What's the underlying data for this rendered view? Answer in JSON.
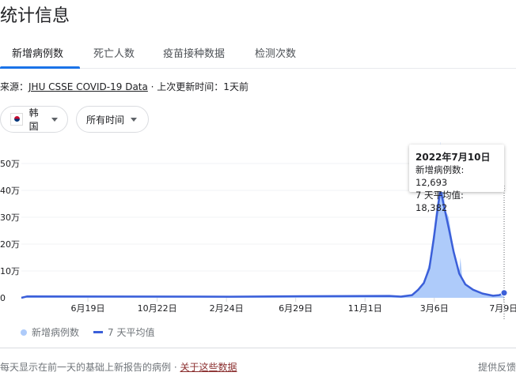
{
  "title": "统计信息",
  "tabs": [
    "新增病例数",
    "死亡人数",
    "疫苗接种数据",
    "检测次数"
  ],
  "source": {
    "prefix": "来源：",
    "link": "JHU CSSE COVID-19 Data",
    "suffix": " · 上次更新时间：1天前"
  },
  "filters": {
    "country": "韩国",
    "range": "所有时间"
  },
  "tooltip": {
    "date": "2022年7月10日",
    "cases": "新增病例数: 12,693",
    "avg": "7 天平均值: 18,382"
  },
  "footer": {
    "note": "每天显示在前一天的基础上新报告的病例 · ",
    "link": "关于这些数据",
    "feedback": "提供反馈"
  },
  "colors": {
    "bar": "#aecbfa",
    "line": "#3b5fd9",
    "accent": "#1a73e8"
  },
  "chart_data": {
    "type": "area",
    "ylim": [
      0,
      500000
    ],
    "y_ticks": [
      {
        "v": 0,
        "label": "0"
      },
      {
        "v": 100000,
        "label": "10万"
      },
      {
        "v": 200000,
        "label": "20万"
      },
      {
        "v": 300000,
        "label": "30万"
      },
      {
        "v": 400000,
        "label": "40万"
      },
      {
        "v": 500000,
        "label": "50万"
      }
    ],
    "x_ticks": [
      {
        "d": "2020-06-19",
        "label": "6月19日"
      },
      {
        "d": "2020-10-22",
        "label": "10月22日"
      },
      {
        "d": "2021-02-24",
        "label": "2月24日"
      },
      {
        "d": "2021-06-29",
        "label": "6月29日"
      },
      {
        "d": "2021-11-01",
        "label": "11月1日"
      },
      {
        "d": "2022-03-06",
        "label": "3月6日"
      },
      {
        "d": "2022-07-09",
        "label": "7月9日"
      }
    ],
    "xlim": [
      "2020-02-20",
      "2022-07-10"
    ],
    "legend": [
      "新增病例数",
      "7 天平均值"
    ],
    "series": [
      {
        "name": "7 天平均值",
        "points": [
          [
            "2020-02-20",
            0
          ],
          [
            "2020-03-01",
            5000
          ],
          [
            "2021-03-01",
            4000
          ],
          [
            "2021-07-20",
            6000
          ],
          [
            "2021-12-15",
            7000
          ],
          [
            "2022-01-05",
            4500
          ],
          [
            "2022-01-25",
            10000
          ],
          [
            "2022-02-05",
            30000
          ],
          [
            "2022-02-15",
            55000
          ],
          [
            "2022-02-25",
            110000
          ],
          [
            "2022-03-05",
            220000
          ],
          [
            "2022-03-10",
            300000
          ],
          [
            "2022-03-17",
            404000
          ],
          [
            "2022-03-22",
            355000
          ],
          [
            "2022-04-01",
            260000
          ],
          [
            "2022-04-10",
            170000
          ],
          [
            "2022-04-20",
            90000
          ],
          [
            "2022-05-01",
            50000
          ],
          [
            "2022-05-15",
            30000
          ],
          [
            "2022-06-01",
            16000
          ],
          [
            "2022-06-20",
            7500
          ],
          [
            "2022-07-01",
            10000
          ],
          [
            "2022-07-10",
            18382
          ]
        ]
      },
      {
        "name": "新增病例数",
        "points": [
          [
            "2020-02-20",
            0
          ],
          [
            "2020-03-01",
            5000
          ],
          [
            "2021-03-01",
            4000
          ],
          [
            "2021-07-20",
            6000
          ],
          [
            "2021-12-15",
            7000
          ],
          [
            "2022-01-05",
            4500
          ],
          [
            "2022-01-25",
            12000
          ],
          [
            "2022-02-05",
            35000
          ],
          [
            "2022-02-15",
            60000
          ],
          [
            "2022-02-25",
            130000
          ],
          [
            "2022-03-05",
            250000
          ],
          [
            "2022-03-10",
            340000
          ],
          [
            "2022-03-16",
            400000
          ],
          [
            "2022-03-17",
            621000
          ],
          [
            "2022-03-18",
            390000
          ],
          [
            "2022-03-22",
            470000
          ],
          [
            "2022-03-25",
            330000
          ],
          [
            "2022-04-01",
            300000
          ],
          [
            "2022-04-10",
            180000
          ],
          [
            "2022-04-20",
            100000
          ],
          [
            "2022-04-22",
            150000
          ],
          [
            "2022-04-26",
            60000
          ],
          [
            "2022-05-15",
            30000
          ],
          [
            "2022-06-01",
            16000
          ],
          [
            "2022-06-20",
            7000
          ],
          [
            "2022-07-01",
            10000
          ],
          [
            "2022-07-10",
            12693
          ]
        ]
      }
    ]
  }
}
